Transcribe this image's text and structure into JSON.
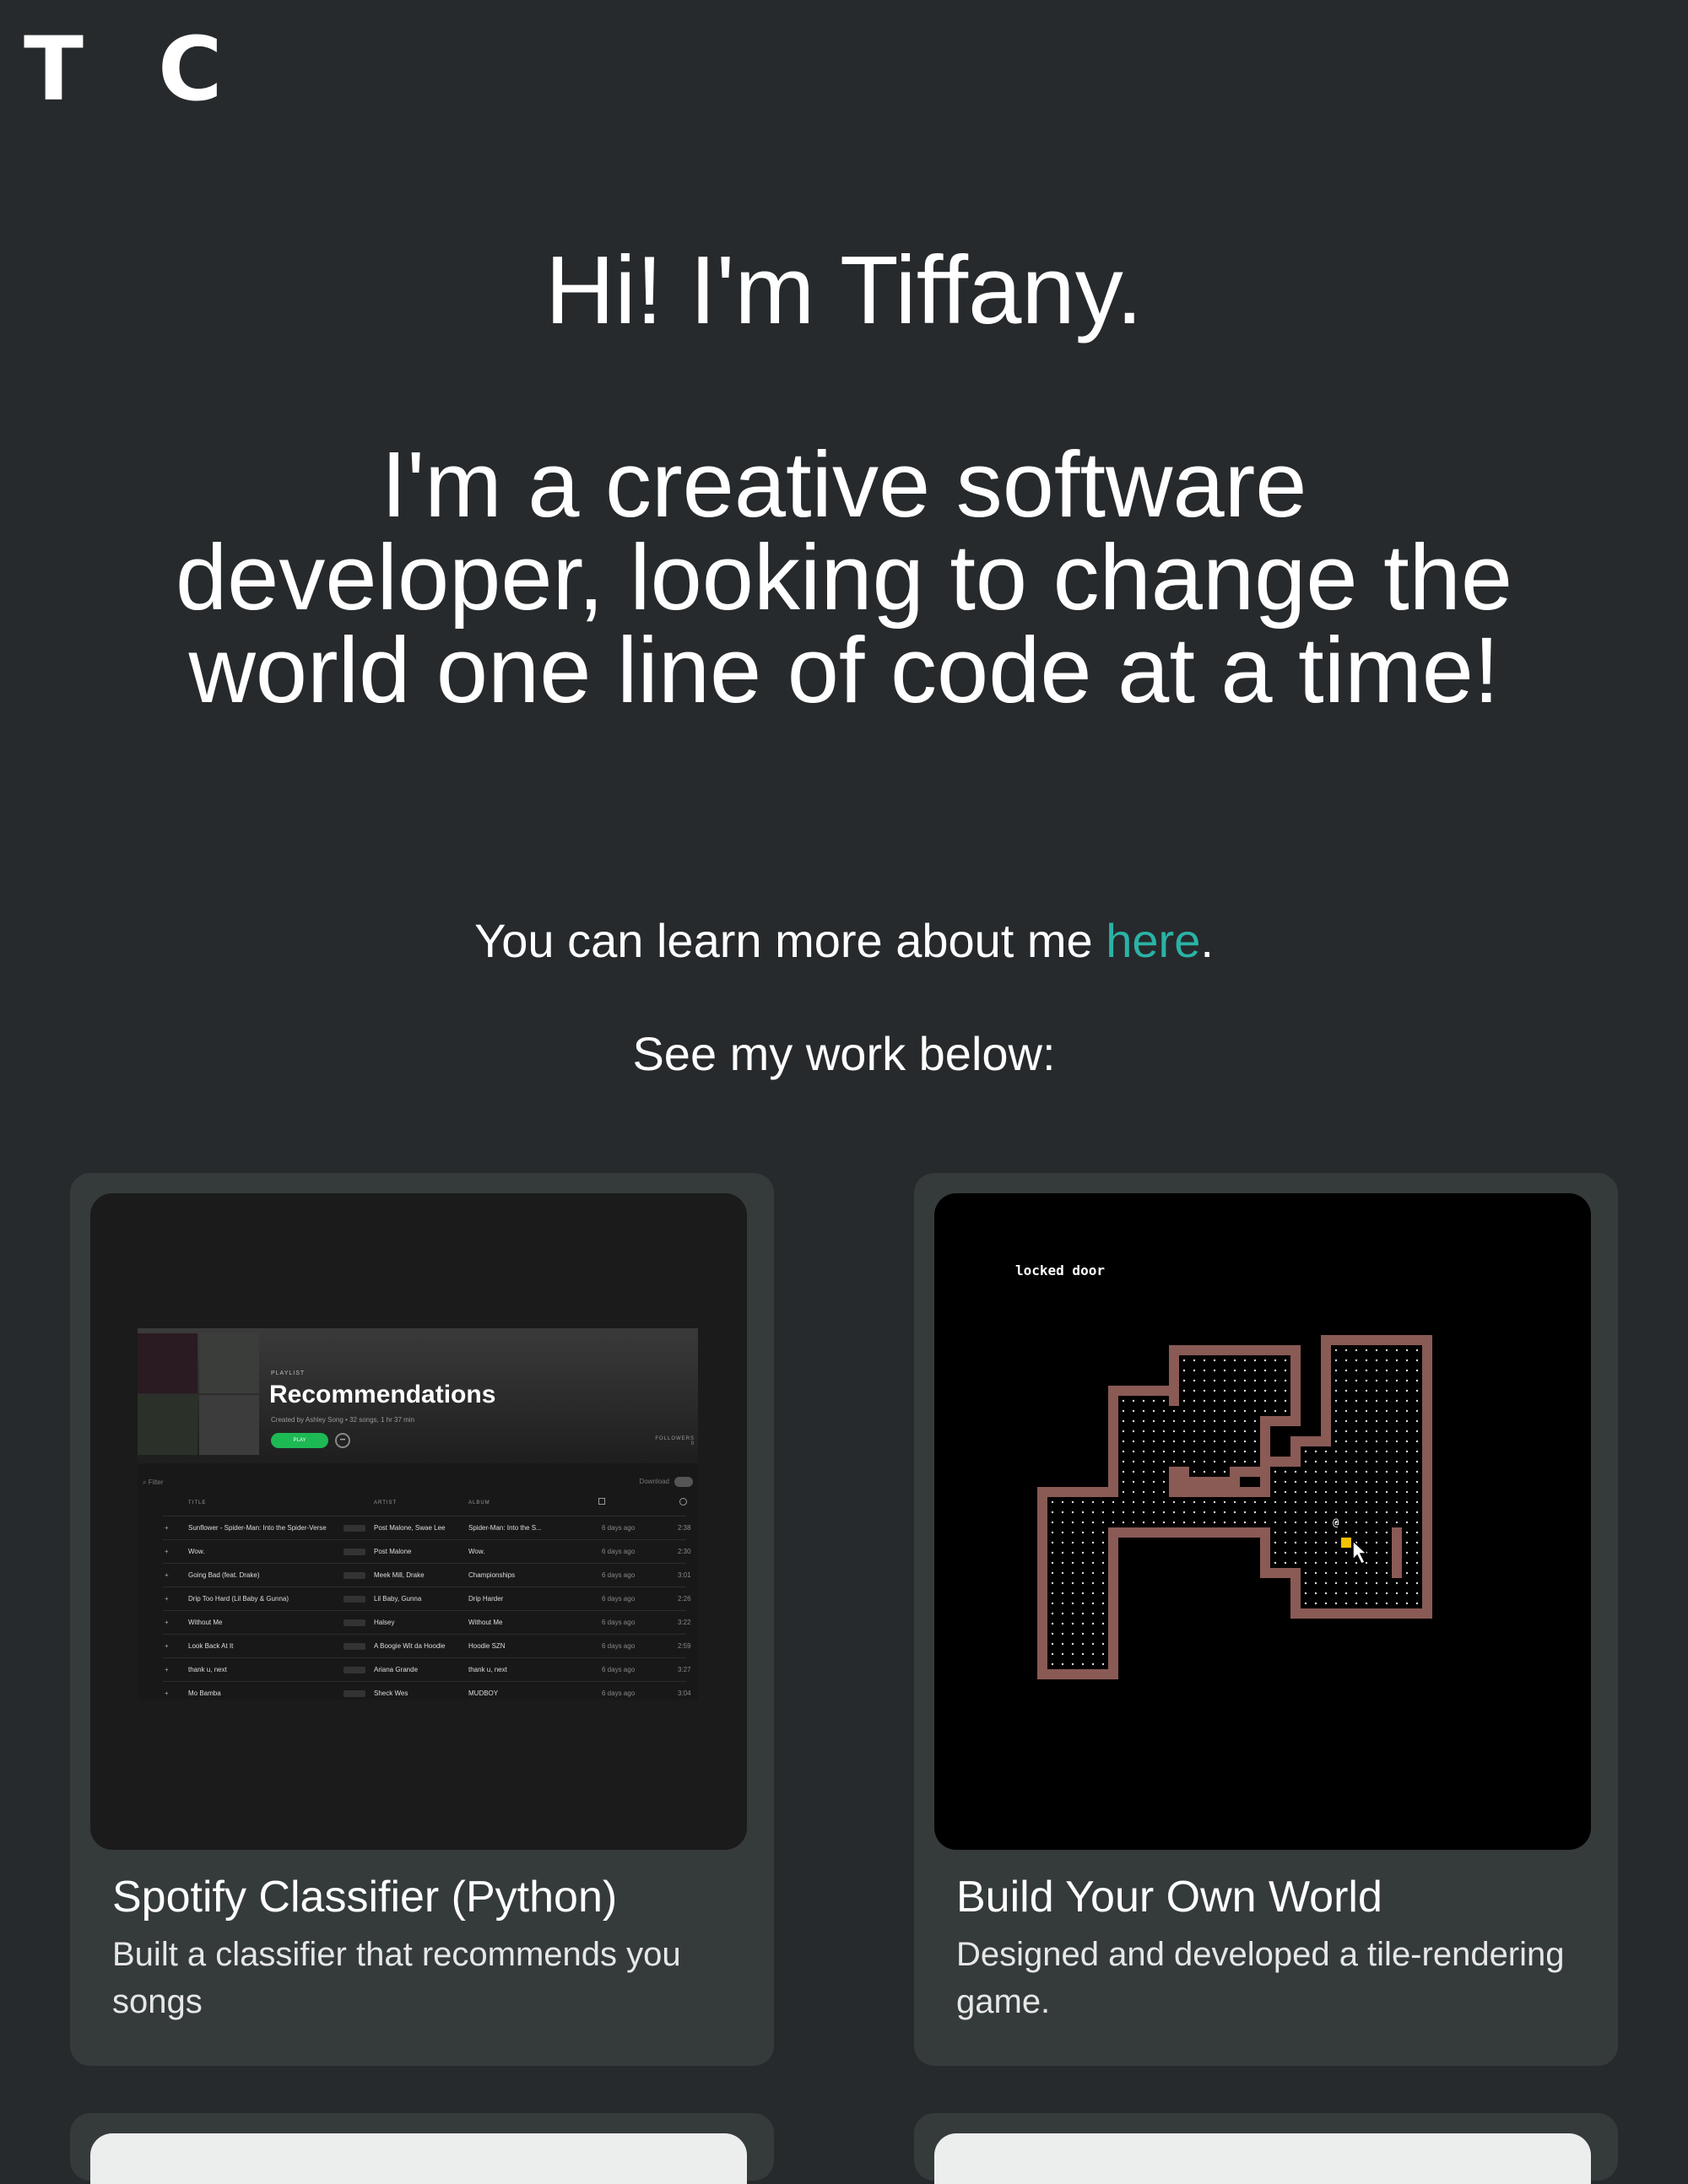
{
  "header": {
    "logo": "T C"
  },
  "hero": {
    "greeting": "Hi! I'm Tiffany.",
    "tagline": "I'm a creative software developer, looking to change the world one line of code at a time!",
    "about_prefix": "You can learn more about me ",
    "about_link": "here",
    "about_suffix": ".",
    "work_lead": "See my work below:"
  },
  "colors": {
    "background": "#272a2c",
    "card": "#353b3b",
    "link": "#2ab3a6",
    "accent_green": "#1db954",
    "wall": "#8a5a55",
    "player_marker": "#f2c200"
  },
  "projects": [
    {
      "title": "Spotify Classifier (Python)",
      "description": "Built a classifier that recommends you songs",
      "preview": {
        "playlist_label": "PLAYLIST",
        "playlist_title": "Recommendations",
        "created_by": "Created by Ashley Song • 32 songs, 1 hr 37 min",
        "play_label": "PLAY",
        "more_label": "•••",
        "followers_label": "FOLLOWERS",
        "followers_count": "0",
        "filter_placeholder": "⌕ Filter",
        "download_label": "Download",
        "columns": {
          "title": "TITLE",
          "artist": "ARTIST",
          "album": "ALBUM",
          "date_icon": "calendar-icon",
          "duration_icon": "clock-icon"
        },
        "tracks": [
          {
            "title": "Sunflower - Spider-Man: Into the Spider-Verse",
            "artist": "Post Malone, Swae Lee",
            "album": "Spider-Man: Into the S...",
            "added": "6 days ago",
            "duration": "2:38"
          },
          {
            "title": "Wow.",
            "artist": "Post Malone",
            "album": "Wow.",
            "added": "6 days ago",
            "duration": "2:30"
          },
          {
            "title": "Going Bad (feat. Drake)",
            "artist": "Meek Mill, Drake",
            "album": "Championships",
            "added": "6 days ago",
            "duration": "3:01"
          },
          {
            "title": "Drip Too Hard (Lil Baby & Gunna)",
            "artist": "Lil Baby, Gunna",
            "album": "Drip Harder",
            "added": "6 days ago",
            "duration": "2:26"
          },
          {
            "title": "Without Me",
            "artist": "Halsey",
            "album": "Without Me",
            "added": "6 days ago",
            "duration": "3:22"
          },
          {
            "title": "Look Back At It",
            "artist": "A Boogie Wit da Hoodie",
            "album": "Hoodie SZN",
            "added": "6 days ago",
            "duration": "2:59"
          },
          {
            "title": "thank u, next",
            "artist": "Ariana Grande",
            "album": "thank u, next",
            "added": "6 days ago",
            "duration": "3:27"
          },
          {
            "title": "Mo Bamba",
            "artist": "Sheck Wes",
            "album": "MUDBOY",
            "added": "6 days ago",
            "duration": "3:04"
          }
        ]
      }
    },
    {
      "title": "Build Your Own World",
      "description": "Designed and developed a tile-rendering game.",
      "preview": {
        "hud_text": "locked door",
        "player_glyph": "@",
        "wall_glyph": "#"
      }
    }
  ]
}
